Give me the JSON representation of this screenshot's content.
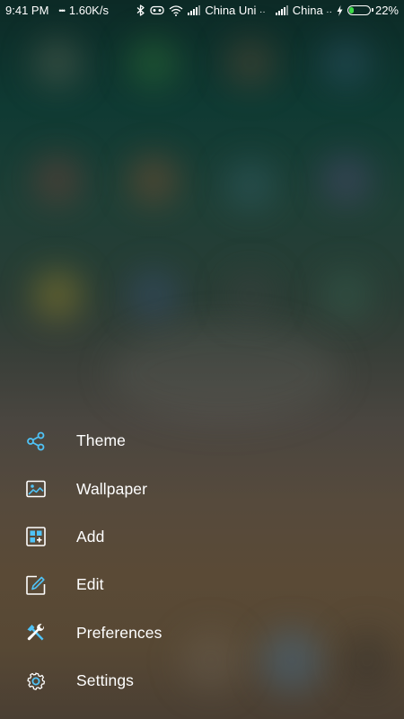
{
  "status_bar": {
    "time": "9:41 PM",
    "more": "•••",
    "speed": "1.60K/s",
    "carrier1": "China Uni",
    "carrier1_suffix": "··",
    "carrier2": "China",
    "carrier2_suffix": "··",
    "battery": "22%",
    "battery_level": 0.22,
    "battery_color": "#3ddc48",
    "icons": [
      "bluetooth-icon",
      "vr-icon",
      "wifi-icon",
      "signal-icon",
      "signal-icon",
      "charging-icon",
      "battery-icon"
    ]
  },
  "accent_color": "#4fc3f7",
  "menu": {
    "items": [
      {
        "label": "Theme",
        "icon": "share-icon"
      },
      {
        "label": "Wallpaper",
        "icon": "image-icon"
      },
      {
        "label": "Add",
        "icon": "add-widget-icon"
      },
      {
        "label": "Edit",
        "icon": "edit-icon"
      },
      {
        "label": "Preferences",
        "icon": "tools-icon"
      },
      {
        "label": "Settings",
        "icon": "gear-icon"
      }
    ]
  }
}
